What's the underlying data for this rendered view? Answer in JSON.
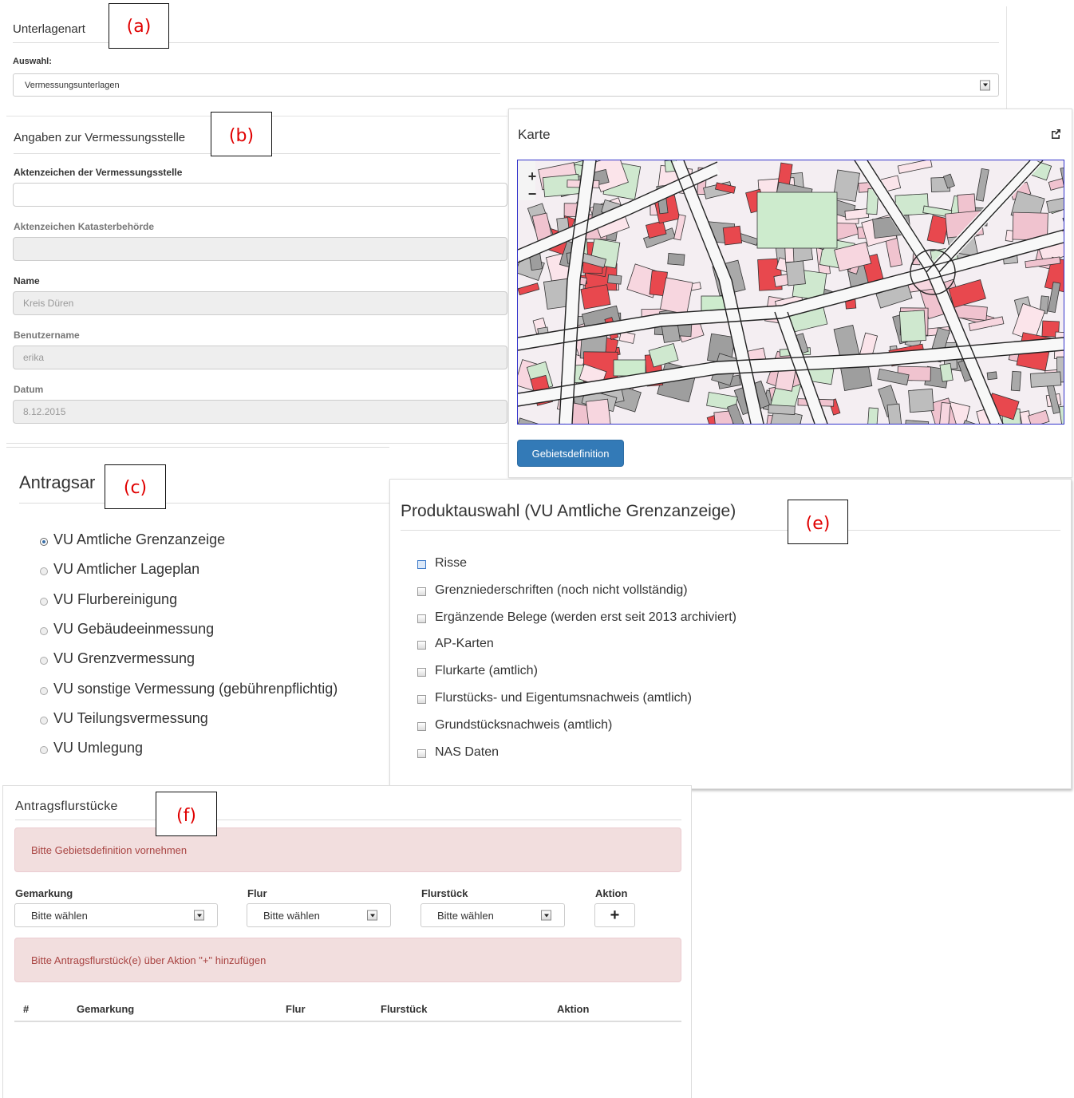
{
  "unterlagenart": {
    "title": "Unterlagenart",
    "tag": "(a)",
    "auswahl_label": "Auswahl:",
    "selected": "Vermessungsunterlagen"
  },
  "vermessungsstelle": {
    "title": "Angaben zur Vermessungsstelle",
    "tag": "(b)",
    "fields": [
      {
        "label": "Aktenzeichen der Vermessungsstelle",
        "value": ""
      },
      {
        "label": "Aktenzeichen Katasterbehörde",
        "value": ""
      },
      {
        "label": "Name",
        "value": "Kreis Düren"
      },
      {
        "label": "Benutzername",
        "value": "erika"
      },
      {
        "label": "Datum",
        "value": "8.12.2015"
      }
    ]
  },
  "karte": {
    "title": "Karte",
    "button": "Gebietsdefinition",
    "zoom_in": "+",
    "zoom_out": "−",
    "icons": [
      "external-link-icon"
    ]
  },
  "antragsart": {
    "title": "Antragsar",
    "tag": "(c)",
    "options": [
      "VU Amtliche Grenzanzeige",
      "VU Amtlicher Lageplan",
      "VU Flurbereinigung",
      "VU Gebäudeeinmessung",
      "VU Grenzvermessung",
      "VU sonstige Vermessung (gebührenpflichtig)",
      "VU Teilungsvermessung",
      "VU Umlegung"
    ],
    "selected_index": 0
  },
  "produktauswahl": {
    "title": "Produktauswahl (VU Amtliche Grenzanzeige)",
    "tag": "(e)",
    "items": [
      "Risse",
      "Grenzniederschriften (noch nicht vollständig)",
      "Ergänzende Belege (werden erst seit 2013 archiviert)",
      "AP-Karten",
      "Flurkarte (amtlich)",
      "Flurstücks- und Eigentumsnachweis (amtlich)",
      "Grundstücksnachweis (amtlich)",
      "NAS Daten"
    ]
  },
  "antragsflurstuecke": {
    "title": "Antragsflurstücke",
    "tag": "(f)",
    "alert1": "Bitte Gebietsdefinition vornehmen",
    "col_gemarkung": "Gemarkung",
    "col_flur": "Flur",
    "col_flurstueck": "Flurstück",
    "col_aktion": "Aktion",
    "sel_gemarkung": "Bitte wählen",
    "sel_flur": "Bitte wählen",
    "sel_flurstueck": "Bitte wählen",
    "add_button": "+",
    "alert2": "Bitte Antragsflurstück(e) über Aktion \"+\" hinzufügen",
    "table_headers": [
      "#",
      "Gemarkung",
      "Flur",
      "Flurstück",
      "Aktion"
    ]
  }
}
